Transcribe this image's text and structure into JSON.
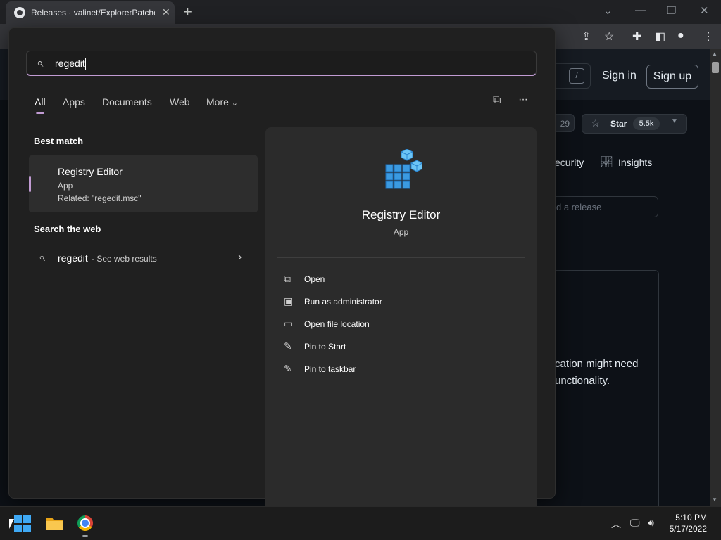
{
  "browser": {
    "tab_title": "Releases · valinet/ExplorerPatcher",
    "tab_close": "✕",
    "new_tab": "+",
    "window_controls": [
      "⌄",
      "—",
      "❐",
      "✕"
    ]
  },
  "github": {
    "search_shortcut": "/",
    "sign_in": "Sign in",
    "sign_up": "Sign up",
    "watch_count": "29",
    "star_label": "Star",
    "star_count": "5.5k",
    "nav_security": "ecurity",
    "nav_insights": "Insights",
    "find_release_placeholder": "d a release",
    "body_line1": "cation might need",
    "body_line2": "unctionality."
  },
  "search": {
    "query": "regedit",
    "tabs": [
      "All",
      "Apps",
      "Documents",
      "Web",
      "More"
    ],
    "more_chevron": "⌄",
    "best_match_title": "Best match",
    "best_match": {
      "name": "Registry Editor",
      "type": "App",
      "related": "Related: \"regedit.msc\""
    },
    "web_section_title": "Search the web",
    "web_result": {
      "query": "regedit",
      "suffix": " - See web results"
    }
  },
  "details": {
    "name": "Registry Editor",
    "type": "App",
    "actions": [
      "Open",
      "Run as administrator",
      "Open file location",
      "Pin to Start",
      "Pin to taskbar"
    ]
  },
  "taskbar": {
    "time": "5:10 PM",
    "date": "5/17/2022"
  },
  "icons": {
    "search": "⌕",
    "chevron_right": "›",
    "star": "☆",
    "ellipsis": "···",
    "chevron_up": "︿"
  },
  "colors": {
    "accent": "#c19bd3",
    "flyout_bg": "#202020",
    "details_bg": "#2b2b2b",
    "github_bg": "#0d1117"
  }
}
